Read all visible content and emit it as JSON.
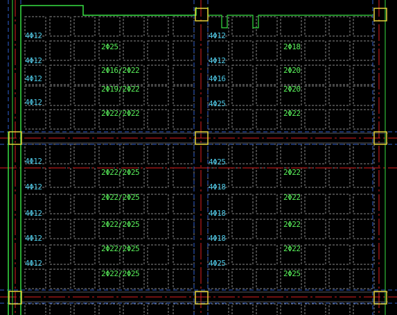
{
  "drawing": {
    "background": "#000000",
    "colors": {
      "grid_white": "#8a8a8a",
      "axis_red": "#e02020",
      "dash_blue": "#2f5fd0",
      "green_outline": "#37e042",
      "column_yellow": "#e6d23a",
      "beam_gray": "#5a5a5a"
    },
    "left_bay_labels": {
      "cyan": [
        "4Φ12",
        "4Φ12",
        "4Φ12",
        "4Φ12",
        "4Φ12",
        "4Φ12",
        "4Φ12",
        "4Φ12",
        "4Φ12",
        "4Φ12"
      ],
      "green": [
        "2Φ25",
        "2Φ16/2Φ22",
        "2Φ19/2Φ22",
        "2Φ22/2Φ22",
        "2Φ22/2Φ25",
        "2Φ22/2Φ25",
        "2Φ22/2Φ25",
        "2Φ22/2Φ25",
        "2Φ22/2Φ25"
      ]
    },
    "right_bay_labels": {
      "cyan": [
        "4Φ12",
        "4Φ12",
        "4Φ16",
        "4Φ25",
        "4Φ25",
        "4Φ18",
        "4Φ18",
        "4Φ18",
        "4Φ25"
      ],
      "green": [
        "2Φ18",
        "2Φ20",
        "2Φ20",
        "2Φ22",
        "2Φ22",
        "2Φ22",
        "2Φ22",
        "2Φ22",
        "2Φ25"
      ]
    }
  }
}
